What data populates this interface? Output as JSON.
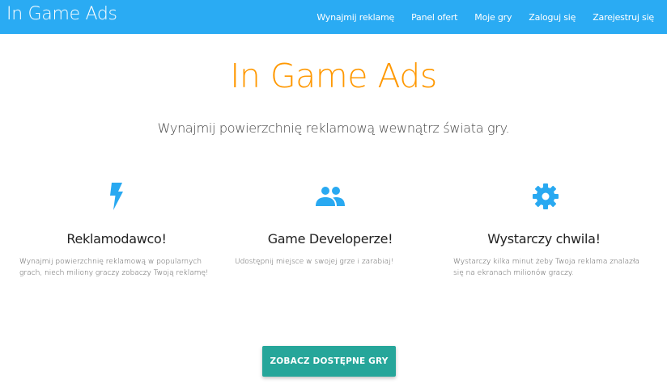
{
  "navbar": {
    "brand": "In Game Ads",
    "links": [
      "Wynajmij reklamę",
      "Panel ofert",
      "Moje gry",
      "Zaloguj się",
      "Zarejestruj się"
    ]
  },
  "hero": {
    "title": "In Game Ads",
    "subtitle": "Wynajmij powierzchnię reklamową wewnątrz świata gry."
  },
  "features": [
    {
      "icon": "lightning-bolt-icon",
      "title": "Reklamodawco!",
      "text": "Wynajmij powierzchnię reklamową w popularnych grach, niech miliony graczy zobaczy Twoją reklamę!"
    },
    {
      "icon": "people-group-icon",
      "title": "Game Developerze!",
      "text": "Udostępnij miejsce w swojej grze i zarabiaj!"
    },
    {
      "icon": "gear-icon",
      "title": "Wystarczy chwila!",
      "text": "Wystarczy kilka minut żeby Twoja reklama znalazła się na ekranach milionów graczy."
    }
  ],
  "cta": {
    "label": "ZOBACZ DOSTĘPNE GRY"
  },
  "colors": {
    "navbar": "#2aabf3",
    "accent_title": "#ff9800",
    "icon": "#29a9f1",
    "button": "#26a69a"
  }
}
